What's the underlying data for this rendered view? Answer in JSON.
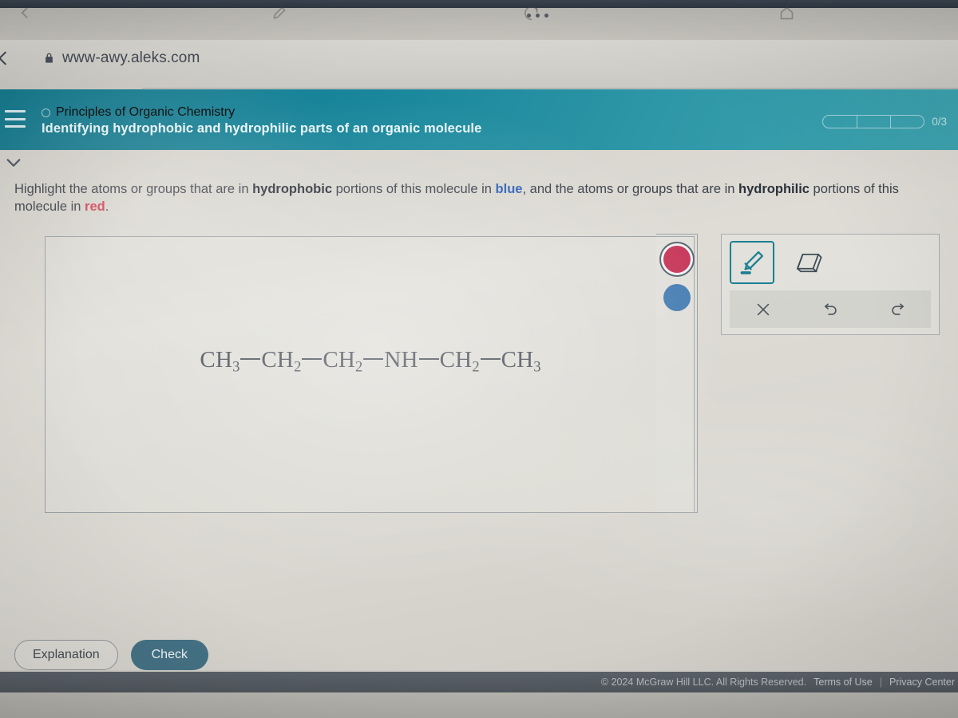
{
  "browser": {
    "url": "www-awy.aleks.com",
    "lock_icon": "lock-icon",
    "back_icon": "back-chevron-icon",
    "tabgroup_icon": "three-dots-icon"
  },
  "header": {
    "menu_icon": "hamburger-menu-icon",
    "course_name": "Principles of Organic Chemistry",
    "course_status_icon": "empty-circle-icon",
    "topic_title": "Identifying hydrophobic and hydrophilic parts of an organic molecule",
    "progress": {
      "label": "0/3",
      "segments": 3,
      "completed": 0
    }
  },
  "panel": {
    "collapse_icon": "chevron-down-icon"
  },
  "instructions": {
    "part1": "Highlight the atoms or groups that are in ",
    "bold1": "hydrophobic",
    "part2": " portions of this molecule in ",
    "keyword_blue": "blue",
    "part3": ", and the atoms or groups that are in ",
    "bold2": "hydrophilic",
    "part4": " portions of this molecule in ",
    "keyword_red": "red",
    "part5": "."
  },
  "molecule": {
    "formula_text": "CH3—CH2—CH2—NH—CH2—CH3",
    "groups": [
      {
        "label": "CH",
        "sub": "3"
      },
      {
        "label": "CH",
        "sub": "2"
      },
      {
        "label": "CH",
        "sub": "2"
      },
      {
        "label": "NH",
        "sub": ""
      },
      {
        "label": "CH",
        "sub": "2"
      },
      {
        "label": "CH",
        "sub": "3"
      }
    ]
  },
  "swatches": {
    "red": {
      "name": "red-color-swatch",
      "color": "#c73a5c",
      "selected": true
    },
    "blue": {
      "name": "blue-color-swatch",
      "color": "#4a7fb4",
      "selected": false
    }
  },
  "tools": {
    "highlighter": {
      "icon": "highlighter-pen-icon",
      "selected": true
    },
    "eraser": {
      "icon": "eraser-icon",
      "selected": false
    },
    "clear": {
      "icon": "close-x-icon"
    },
    "undo": {
      "icon": "undo-arrow-icon"
    },
    "redo": {
      "icon": "redo-arrow-icon"
    }
  },
  "actions": {
    "explanation_label": "Explanation",
    "check_label": "Check"
  },
  "footer": {
    "copyright": "© 2024 McGraw Hill LLC. All Rights Reserved.",
    "terms_label": "Terms of Use",
    "separator": "|",
    "privacy_label": "Privacy Center"
  },
  "taskbar": {
    "icons": [
      "back-arrow-icon",
      "pen-icon",
      "chrome-icon",
      "home-icon"
    ]
  }
}
